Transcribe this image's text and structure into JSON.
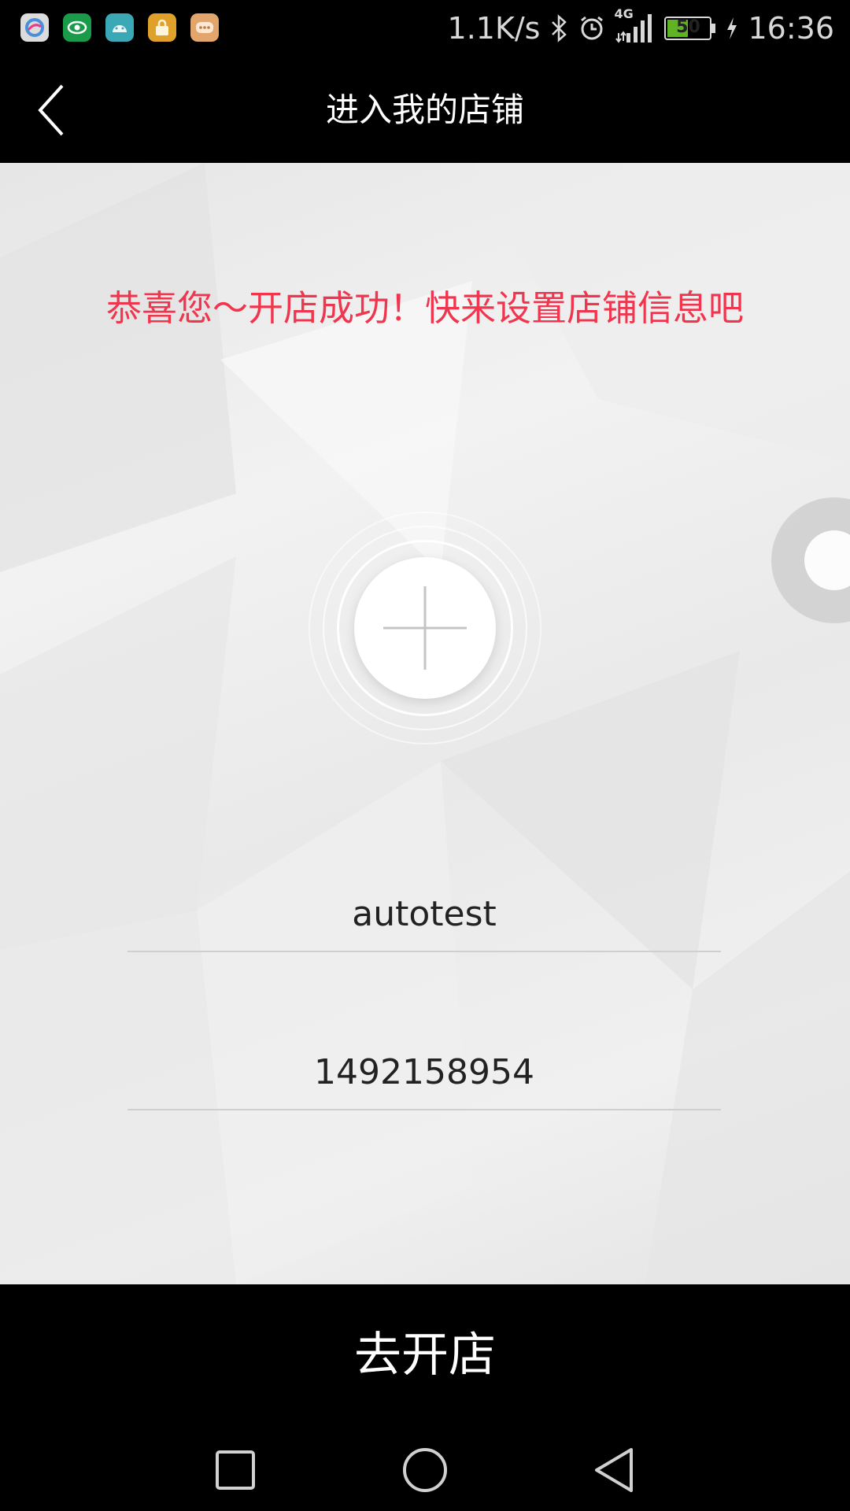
{
  "status_bar": {
    "apps": [
      "china-mobile-app-icon",
      "eye-app-icon",
      "android-app-icon",
      "lock-app-icon",
      "chat-app-icon"
    ],
    "network_speed": "1.1K/s",
    "network_type": "4G",
    "battery": "50",
    "time": "16:36"
  },
  "header": {
    "title": "进入我的店铺"
  },
  "main": {
    "congrats": "恭喜您～开店成功！快来设置店铺信息吧",
    "shop_name": "autotest",
    "shop_number": "1492158954"
  },
  "action": {
    "label": "去开店"
  },
  "colors": {
    "accent": "#f0364e",
    "bar": "#000000"
  }
}
